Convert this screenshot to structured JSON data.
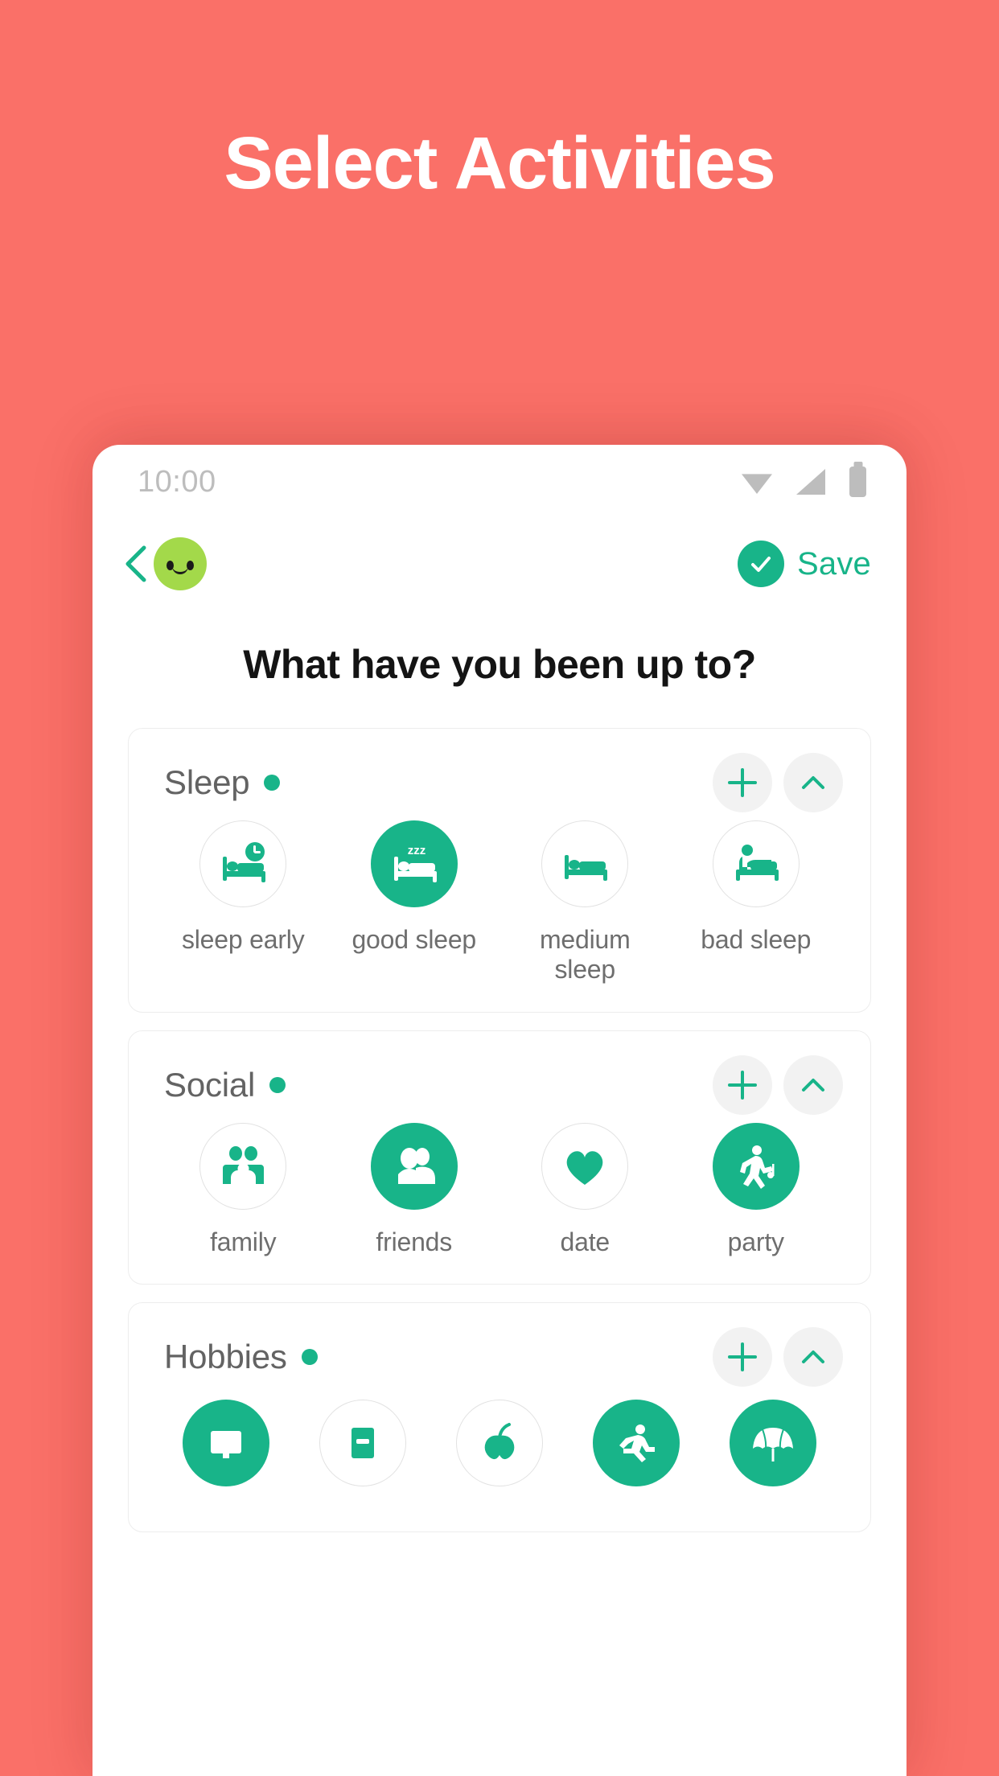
{
  "promo": {
    "title": "Select Activities",
    "background_color": "#FA7068",
    "title_color": "#FFFFFF"
  },
  "theme": {
    "accent": "#18B489",
    "avatar_green": "#A3D94A",
    "muted_text": "#6E6E6E",
    "card_border": "#EDEDED",
    "chip_bg": "#F2F2F2"
  },
  "statusbar": {
    "time": "10:00",
    "icons": [
      "wifi-icon",
      "signal-icon",
      "battery-icon"
    ]
  },
  "header": {
    "back_icon": "chevron-left-icon",
    "avatar_icon": "smiley-avatar",
    "save_icon": "check-circle-icon",
    "save_label": "Save"
  },
  "main": {
    "question": "What have you been up to?"
  },
  "sections": [
    {
      "title": "Sleep",
      "dot": true,
      "add_label": "+",
      "collapse_icon": "chevron-up-icon",
      "items": [
        {
          "label": "sleep early",
          "icon": "bed-clock-icon",
          "selected": false
        },
        {
          "label": "good sleep",
          "icon": "bed-zzz-icon",
          "selected": true
        },
        {
          "label": "medium sleep",
          "icon": "bed-icon",
          "selected": false
        },
        {
          "label": "bad sleep",
          "icon": "bed-awake-icon",
          "selected": false
        }
      ]
    },
    {
      "title": "Social",
      "dot": true,
      "add_label": "+",
      "collapse_icon": "chevron-up-icon",
      "items": [
        {
          "label": "family",
          "icon": "family-icon",
          "selected": false
        },
        {
          "label": "friends",
          "icon": "friends-icon",
          "selected": true
        },
        {
          "label": "date",
          "icon": "heart-icon",
          "selected": false
        },
        {
          "label": "party",
          "icon": "dancing-icon",
          "selected": true
        }
      ]
    },
    {
      "title": "Hobbies",
      "dot": true,
      "add_label": "+",
      "collapse_icon": "chevron-up-icon",
      "items": [
        {
          "label": "",
          "icon": "tv-icon",
          "selected": true
        },
        {
          "label": "",
          "icon": "book-icon",
          "selected": false
        },
        {
          "label": "",
          "icon": "plant-icon",
          "selected": false
        },
        {
          "label": "",
          "icon": "running-icon",
          "selected": true
        },
        {
          "label": "",
          "icon": "umbrella-icon",
          "selected": true
        }
      ]
    }
  ]
}
